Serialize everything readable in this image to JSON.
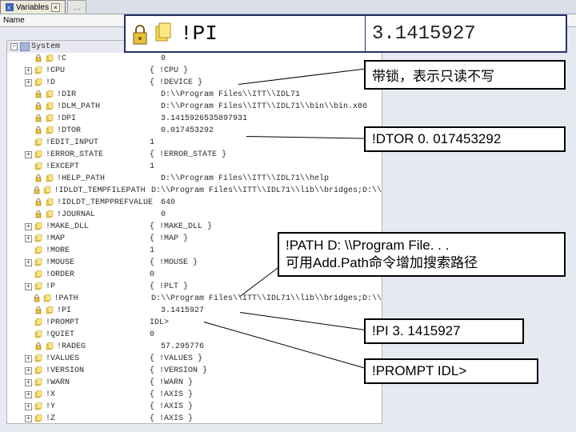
{
  "tabs": {
    "t1": "Variables",
    "close": "×",
    "t2": "…"
  },
  "big": {
    "name": "!PI",
    "value": "3.1415927"
  },
  "header": {
    "name": "Name"
  },
  "sys": {
    "label": "System"
  },
  "rows": [
    {
      "k": "!C",
      "v": "0"
    },
    {
      "k": "!CPU",
      "v": "{ !CPU   }"
    },
    {
      "k": "!D",
      "v": "{ !DEVICE   }"
    },
    {
      "k": "!DIR",
      "v": "D:\\\\Program Files\\\\ITT\\\\IDL71"
    },
    {
      "k": "!DLM_PATH",
      "v": "D:\\\\Program Files\\\\ITT\\\\IDL71\\\\bin\\\\bin.x86"
    },
    {
      "k": "!DPI",
      "v": "3.1415926535897931"
    },
    {
      "k": "!DTOR",
      "v": "0.017453292"
    },
    {
      "k": "!EDIT_INPUT",
      "v": "1"
    },
    {
      "k": "!ERROR_STATE",
      "v": "{ !ERROR_STATE   }"
    },
    {
      "k": "!EXCEPT",
      "v": "1"
    },
    {
      "k": "!HELP_PATH",
      "v": "D:\\\\Program Files\\\\ITT\\\\IDL71\\\\help"
    },
    {
      "k": "!IDLDT_TEMPFILEPATH",
      "v": "D:\\\\Program Files\\\\ITT\\\\IDL71\\\\lib\\\\bridges;D:\\\\"
    },
    {
      "k": "!IDLDT_TEMPPREFVALUE",
      "v": "640"
    },
    {
      "k": "!JOURNAL",
      "v": "0"
    },
    {
      "k": "!MAKE_DLL",
      "v": "{ !MAKE_DLL   }"
    },
    {
      "k": "!MAP",
      "v": "{ !MAP   }"
    },
    {
      "k": "!MORE",
      "v": "1"
    },
    {
      "k": "!MOUSE",
      "v": "{ !MOUSE   }"
    },
    {
      "k": "!ORDER",
      "v": "0"
    },
    {
      "k": "!P",
      "v": "{ !PLT   }"
    },
    {
      "k": "!PATH",
      "v": "D:\\\\Program Files\\\\ITT\\\\IDL71\\\\lib\\\\bridges;D:\\\\"
    },
    {
      "k": "!PI",
      "v": "3.1415927"
    },
    {
      "k": "!PROMPT",
      "v": "IDL>"
    },
    {
      "k": "!QUIET",
      "v": "0"
    },
    {
      "k": "!RADEG",
      "v": "57.295776"
    },
    {
      "k": "!VALUES",
      "v": "{ !VALUES   }"
    },
    {
      "k": "!VERSION",
      "v": "{ !VERSION   }"
    },
    {
      "k": "!WARN",
      "v": "{ !WARN   }"
    },
    {
      "k": "!X",
      "v": "{ !AXIS   }"
    },
    {
      "k": "!Y",
      "v": "{ !AXIS   }"
    },
    {
      "k": "!Z",
      "v": "{ !AXIS   }"
    }
  ],
  "expandable": [
    "!CPU",
    "!D",
    "!ERROR_STATE",
    "!MAKE_DLL",
    "!MAP",
    "!MOUSE",
    "!P",
    "!VALUES",
    "!VERSION",
    "!WARN",
    "!X",
    "!Y",
    "!Z"
  ],
  "locked": [
    "!C",
    "!DIR",
    "!DLM_PATH",
    "!DPI",
    "!DTOR",
    "!HELP_PATH",
    "!IDLDT_TEMPFILEPATH",
    "!IDLDT_TEMPPREFVALUE",
    "!JOURNAL",
    "!PATH",
    "!PI",
    "!RADEG"
  ],
  "callouts": {
    "c1": "带锁，表示只读不写",
    "c2": "!DTOR  0. 017453292",
    "c3a": "!PATH   D: \\\\Program File. . .",
    "c3b": "可用Add.Path命令增加搜索路径",
    "c4": "!PI  3. 1415927",
    "c5": "!PROMPT   IDL>"
  }
}
